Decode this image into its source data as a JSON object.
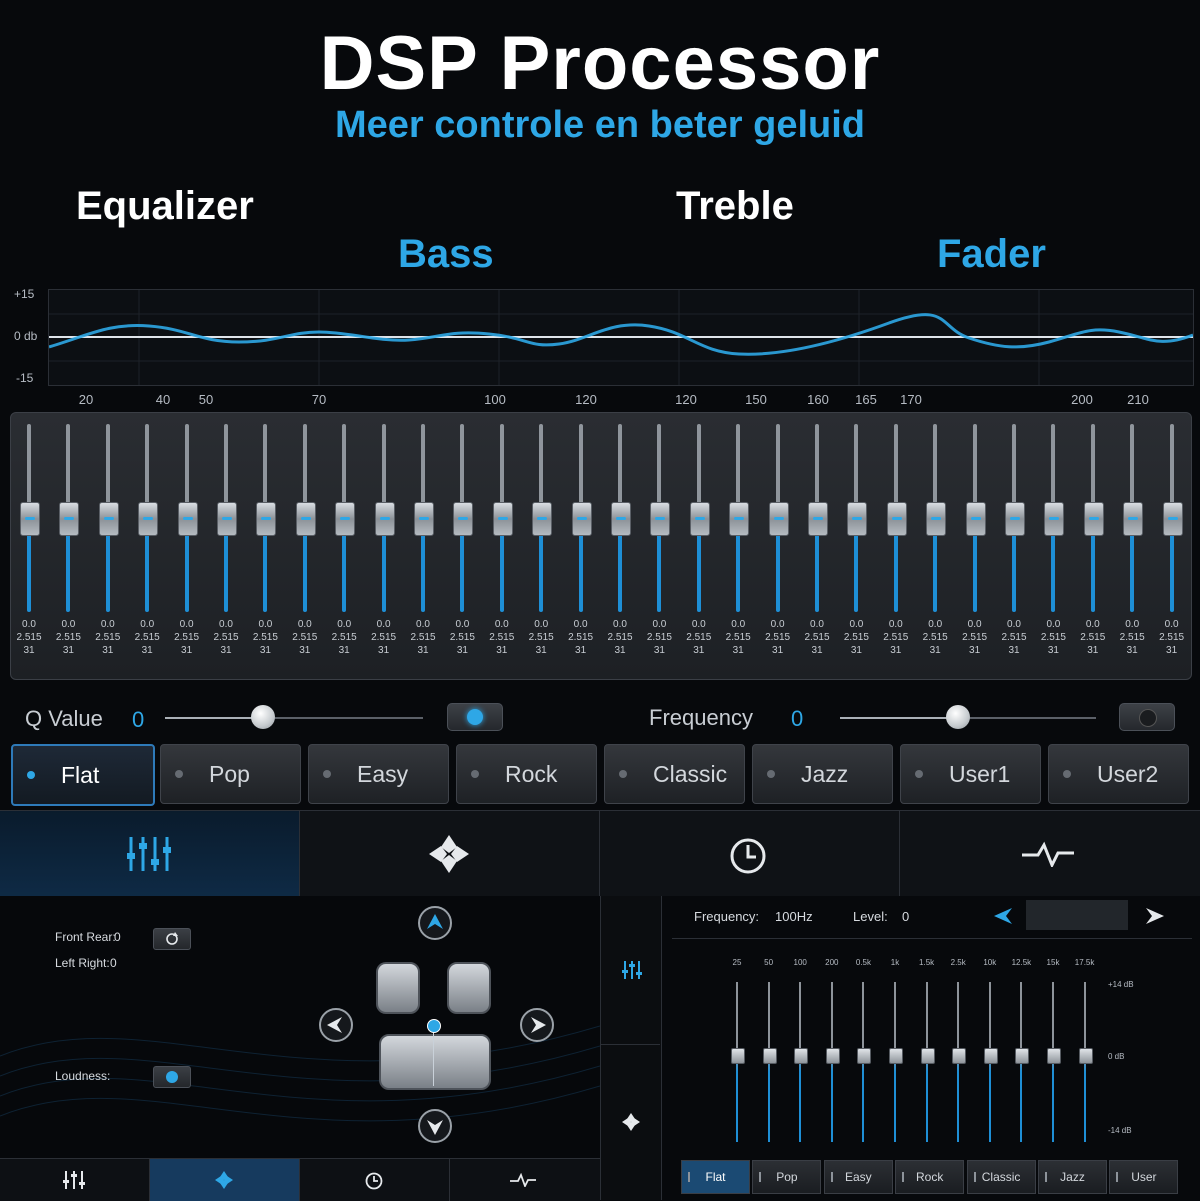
{
  "header": {
    "title": "DSP Processor",
    "subtitle": "Meer controle en beter geluid"
  },
  "features": {
    "equalizer": "Equalizer",
    "treble": "Treble",
    "bass": "Bass",
    "fader": "Fader"
  },
  "graph": {
    "y_top": "+15",
    "y_mid": "0 db",
    "y_bottom": "-15",
    "freq_labels": [
      "20",
      "40",
      "50",
      "70",
      "100",
      "120",
      "120",
      "150",
      "160",
      "165",
      "170",
      "200",
      "210"
    ]
  },
  "eq": {
    "band_count": 30,
    "band_gain": "0.0",
    "band_q": "2.515",
    "band_level": "31",
    "level_fraction": 0.5
  },
  "controls": {
    "q_label": "Q Value",
    "q_value": "0",
    "q_position": 0.38,
    "freq_label": "Frequency",
    "freq_value": "0",
    "freq_position": 0.46,
    "q_toggle_on": true,
    "freq_toggle_on": false
  },
  "presets": [
    {
      "label": "Flat",
      "active": true
    },
    {
      "label": "Pop",
      "active": false
    },
    {
      "label": "Easy",
      "active": false
    },
    {
      "label": "Rock",
      "active": false
    },
    {
      "label": "Classic",
      "active": false
    },
    {
      "label": "Jazz",
      "active": false
    },
    {
      "label": "User1",
      "active": false
    },
    {
      "label": "User2",
      "active": false
    }
  ],
  "tabs": [
    {
      "icon": "equalizer-icon",
      "active": true
    },
    {
      "icon": "fader-balance-icon",
      "active": false
    },
    {
      "icon": "clock-icon",
      "active": false
    },
    {
      "icon": "waveform-icon",
      "active": false
    }
  ],
  "fader": {
    "front_rear_label": "Front Rear:",
    "front_rear_value": "0",
    "left_right_label": "Left Right:",
    "left_right_value": "0",
    "loudness_label": "Loudness:"
  },
  "geq": {
    "frequency_label": "Frequency:",
    "frequency_value": "100Hz",
    "level_label": "Level:",
    "level_value": "0",
    "bands": [
      "25",
      "50",
      "100",
      "200",
      "0.5k",
      "1k",
      "1.5k",
      "2.5k",
      "10k",
      "12.5k",
      "15k",
      "17.5k"
    ],
    "scale_top": "+14  dB",
    "scale_mid": "0  dB",
    "scale_bottom": "-14  dB",
    "presets": [
      {
        "label": "Flat",
        "active": true
      },
      {
        "label": "Pop",
        "active": false
      },
      {
        "label": "Easy",
        "active": false
      },
      {
        "label": "Rock",
        "active": false
      },
      {
        "label": "Classic",
        "active": false
      },
      {
        "label": "Jazz",
        "active": false
      },
      {
        "label": "User",
        "active": false
      }
    ]
  },
  "colors": {
    "accent": "#2ea7e6",
    "background": "#07090c"
  }
}
